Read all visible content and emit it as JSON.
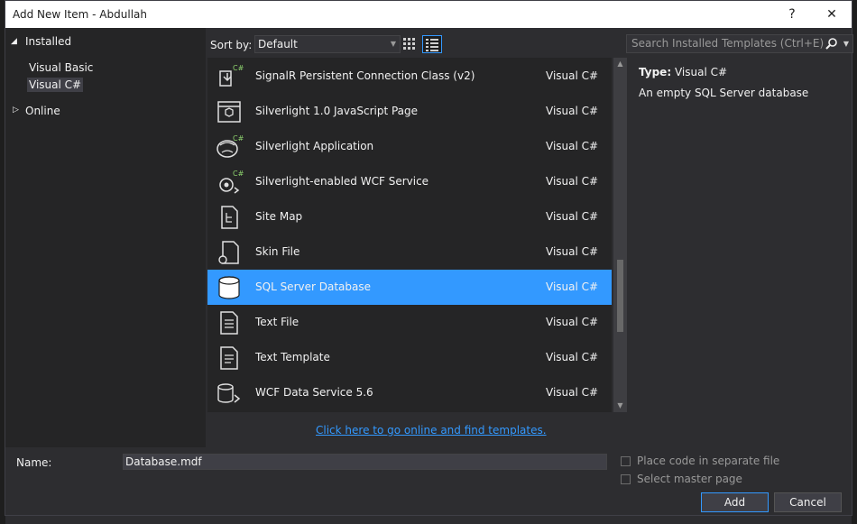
{
  "window": {
    "title": "Add New Item - Abdullah",
    "help_label": "?",
    "close_label": "✕"
  },
  "tree": {
    "installed_label": "Installed",
    "visual_basic_label": "Visual Basic",
    "visual_csharp_label": "Visual C#",
    "online_label": "Online"
  },
  "toolbar": {
    "sort_label": "Sort by:",
    "sort_value": "Default",
    "search_placeholder": "Search Installed Templates (Ctrl+E)"
  },
  "templates": [
    {
      "name": "SignalR Persistent Connection Class (v2)",
      "language": "Visual C#",
      "icon": "signalr-icon",
      "selected": false
    },
    {
      "name": "Silverlight 1.0 JavaScript Page",
      "language": "Visual C#",
      "icon": "silverlight-js-page-icon",
      "selected": false
    },
    {
      "name": "Silverlight Application",
      "language": "Visual C#",
      "icon": "silverlight-app-icon",
      "selected": false
    },
    {
      "name": "Silverlight-enabled WCF Service",
      "language": "Visual C#",
      "icon": "wcf-service-icon",
      "selected": false
    },
    {
      "name": "Site Map",
      "language": "Visual C#",
      "icon": "site-map-icon",
      "selected": false
    },
    {
      "name": "Skin File",
      "language": "Visual C#",
      "icon": "skin-file-icon",
      "selected": false
    },
    {
      "name": "SQL Server Database",
      "language": "Visual C#",
      "icon": "database-icon",
      "selected": true
    },
    {
      "name": "Text File",
      "language": "Visual C#",
      "icon": "text-file-icon",
      "selected": false
    },
    {
      "name": "Text Template",
      "language": "Visual C#",
      "icon": "text-template-icon",
      "selected": false
    },
    {
      "name": "WCF Data Service 5.6",
      "language": "Visual C#",
      "icon": "wcf-data-service-icon",
      "selected": false
    }
  ],
  "details": {
    "type_label": "Type:",
    "type_value": "Visual C#",
    "description": "An empty SQL Server database"
  },
  "online_link": "Click here to go online and find templates.",
  "form": {
    "name_label": "Name:",
    "name_value": "Database.mdf",
    "place_code_label": "Place code in separate file",
    "master_page_label": "Select master page"
  },
  "buttons": {
    "add_label": "Add",
    "cancel_label": "Cancel"
  },
  "colors": {
    "accent": "#3399ff",
    "background": "#2d2d30",
    "pane": "#252526"
  }
}
